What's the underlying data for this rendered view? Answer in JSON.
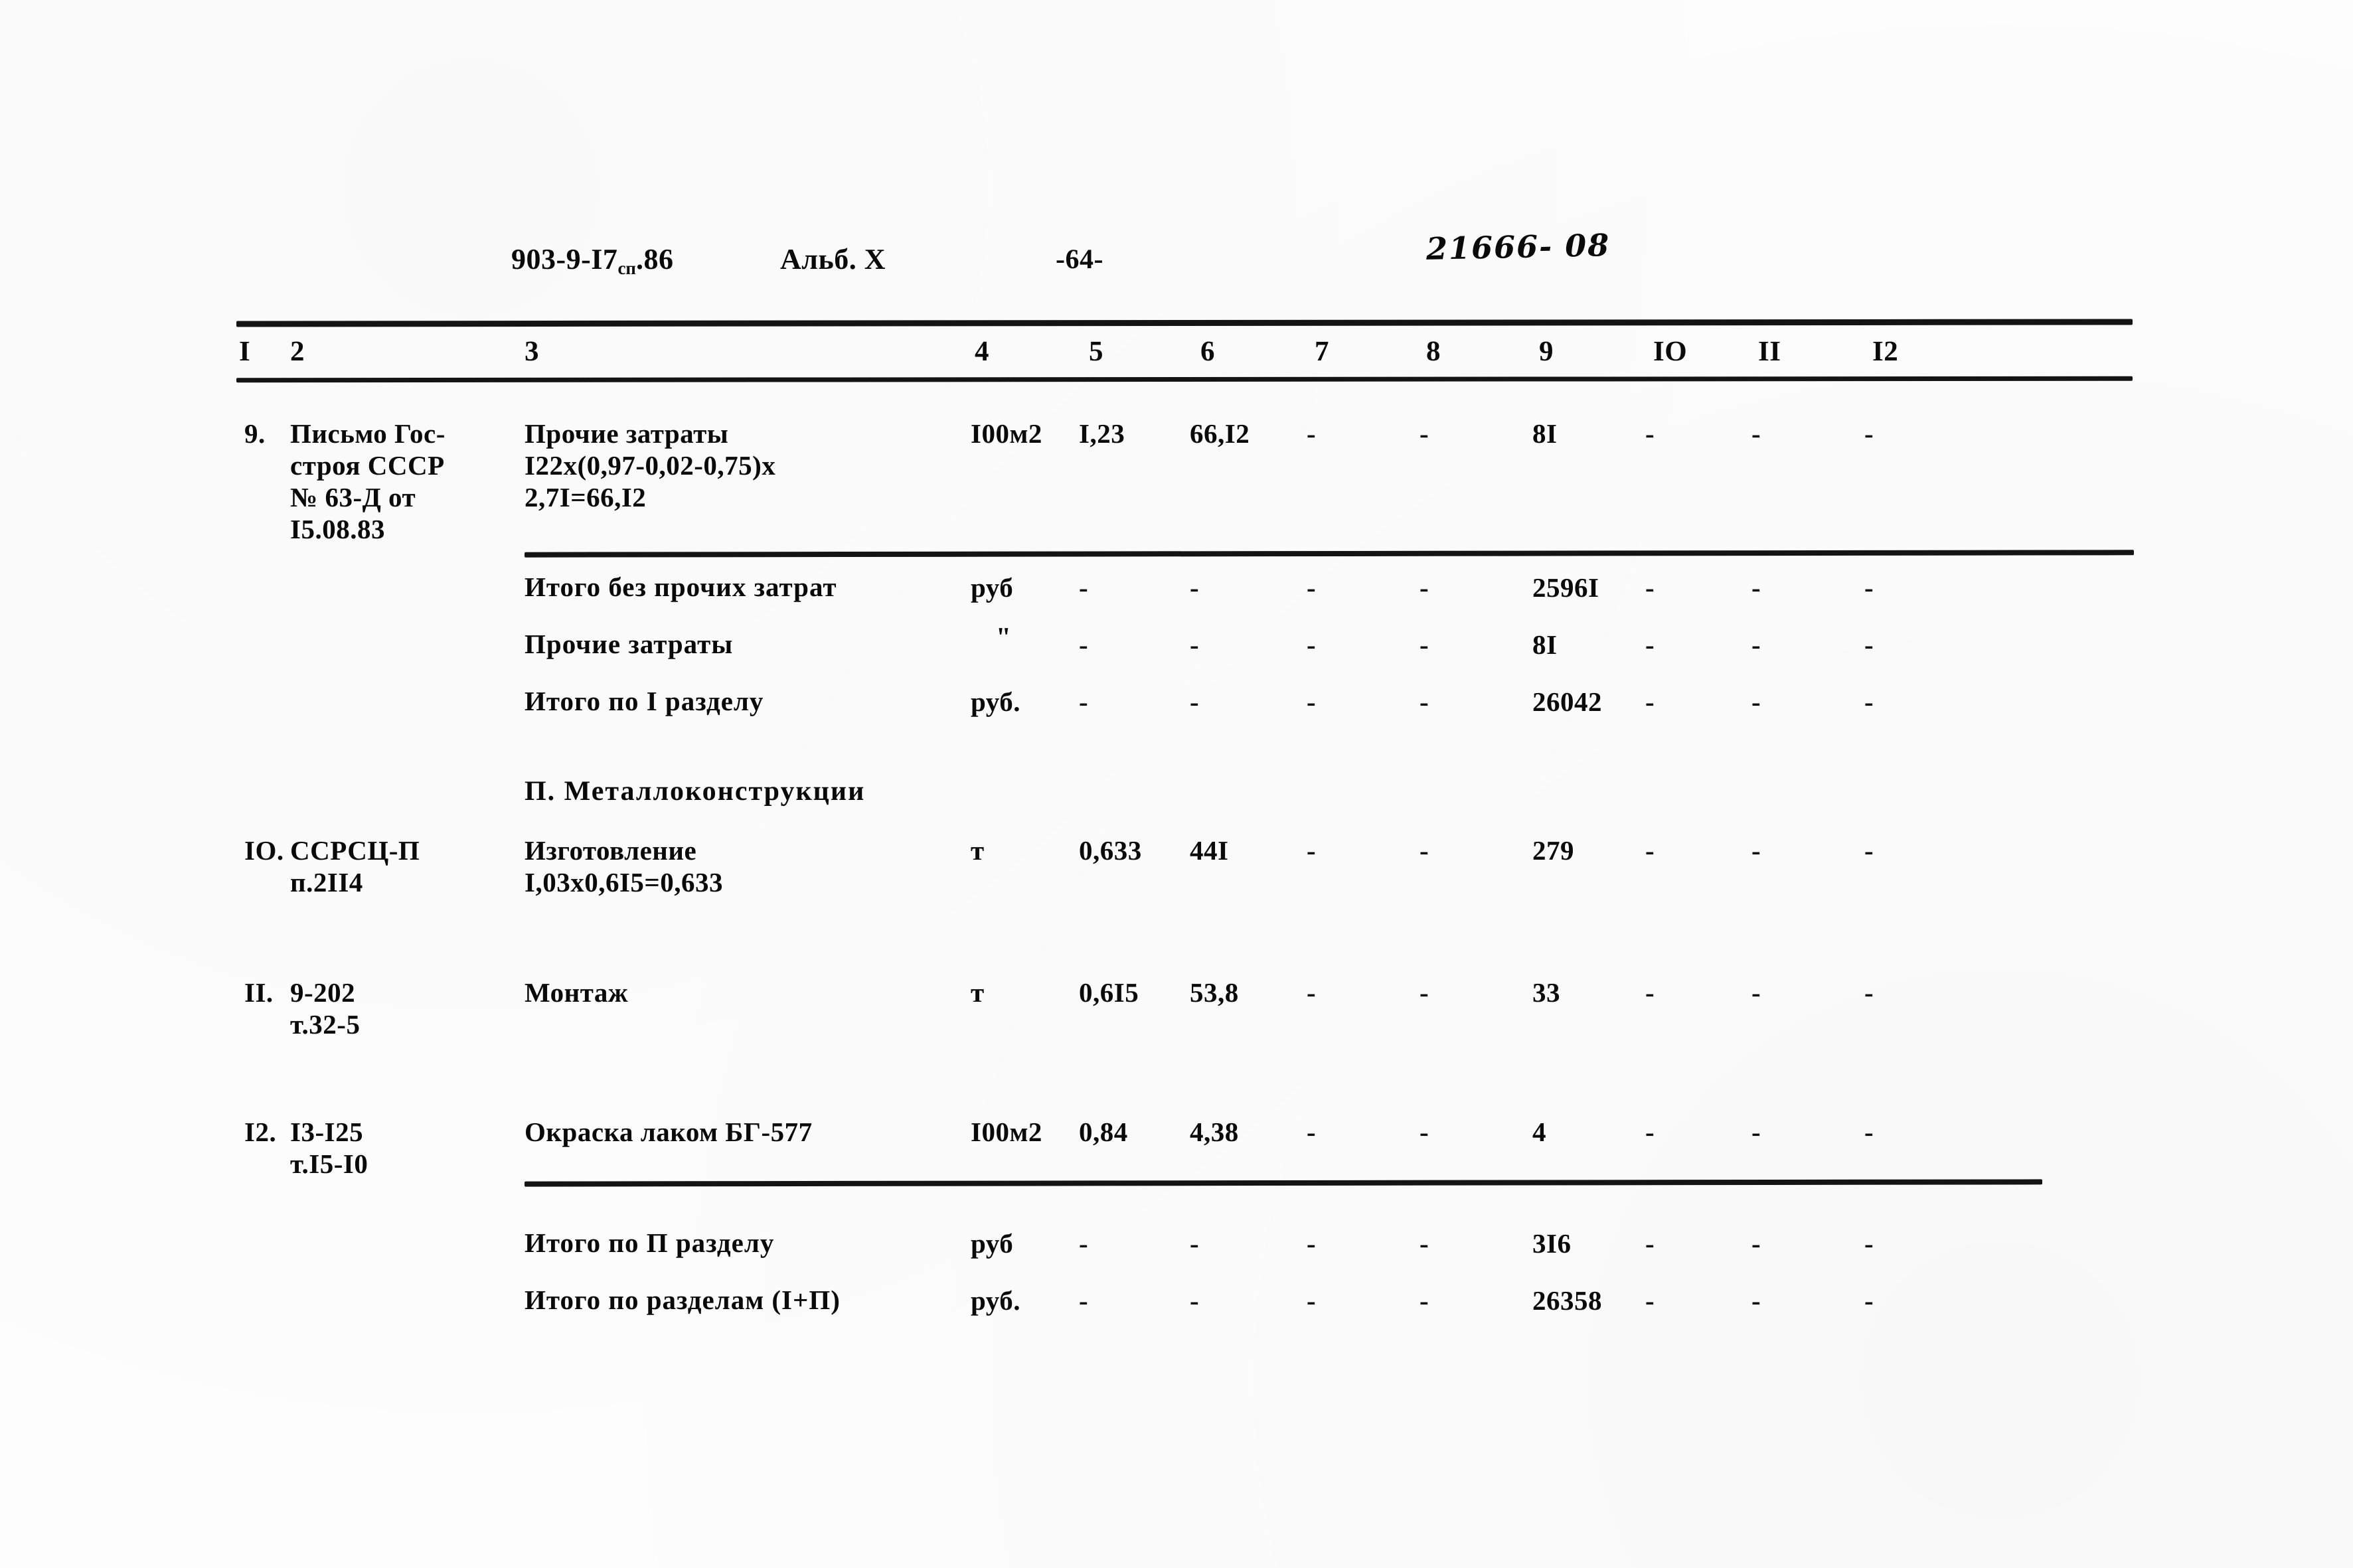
{
  "header": {
    "doc_code_main": "903-9-I7",
    "doc_code_sub": "сп",
    "doc_code_tail": ".86",
    "album_label": "Альб. Х",
    "page_number": "-64-",
    "archive_number": "21666- 08"
  },
  "table": {
    "column_numbers": [
      "I",
      "2",
      "3",
      "4",
      "5",
      "6",
      "7",
      "8",
      "9",
      "IO",
      "II",
      "I2"
    ],
    "rows": [
      {
        "kind": "item",
        "ordinal": "9.",
        "justification": [
          "Письмо Гос-",
          "строя СССР",
          "№ 63-Д от",
          "I5.08.83"
        ],
        "description": [
          "Прочие затраты",
          "I22х(0,97-0,02-0,75)х",
          "2,7I=66,I2"
        ],
        "unit": "I00м2",
        "col5": "I,23",
        "col6": "66,I2",
        "col7": "-",
        "col8": "-",
        "col9": "8I",
        "col10": "-",
        "col11": "-",
        "col12": "-"
      },
      {
        "kind": "summary",
        "label": "Итого без прочих затрат",
        "unit": "руб",
        "col5": "-",
        "col6": "-",
        "col7": "-",
        "col8": "-",
        "col9": "2596I",
        "col10": "-",
        "col11": "-",
        "col12": "-"
      },
      {
        "kind": "summary",
        "label": "Прочие затраты",
        "unit": "\"",
        "col5": "-",
        "col6": "-",
        "col7": "-",
        "col8": "-",
        "col9": "8I",
        "col10": "-",
        "col11": "-",
        "col12": "-"
      },
      {
        "kind": "summary",
        "label": "Итого по I разделу",
        "unit": "руб.",
        "col5": "-",
        "col6": "-",
        "col7": "-",
        "col8": "-",
        "col9": "26042",
        "col10": "-",
        "col11": "-",
        "col12": "-"
      },
      {
        "kind": "section",
        "title": "П. Металлоконструкции"
      },
      {
        "kind": "item",
        "ordinal": "IO.",
        "justification": [
          "ССРСЦ-П",
          "п.2II4"
        ],
        "description": [
          "Изготовление",
          "I,03х0,6I5=0,633"
        ],
        "unit": "т",
        "col5": "0,633",
        "col6": "44I",
        "col7": "-",
        "col8": "-",
        "col9": "279",
        "col10": "-",
        "col11": "-",
        "col12": "-"
      },
      {
        "kind": "item",
        "ordinal": "II.",
        "justification": [
          "9-202",
          "т.32-5"
        ],
        "description": [
          "Монтаж"
        ],
        "unit": "т",
        "col5": "0,6I5",
        "col6": "53,8",
        "col7": "-",
        "col8": "-",
        "col9": "33",
        "col10": "-",
        "col11": "-",
        "col12": "-"
      },
      {
        "kind": "item",
        "ordinal": "I2.",
        "justification": [
          "I3-I25",
          "т.I5-I0"
        ],
        "description": [
          "Окраска лаком БГ-577"
        ],
        "unit": "I00м2",
        "col5": "0,84",
        "col6": "4,38",
        "col7": "-",
        "col8": "-",
        "col9": "4",
        "col10": "-",
        "col11": "-",
        "col12": "-"
      },
      {
        "kind": "summary",
        "label": "Итого по П разделу",
        "unit": "руб",
        "col5": "-",
        "col6": "-",
        "col7": "-",
        "col8": "-",
        "col9": "3I6",
        "col10": "-",
        "col11": "-",
        "col12": "-"
      },
      {
        "kind": "summary",
        "label": "Итого по разделам (I+П)",
        "unit": "руб.",
        "col5": "-",
        "col6": "-",
        "col7": "-",
        "col8": "-",
        "col9": "26358",
        "col10": "-",
        "col11": "-",
        "col12": "-"
      }
    ]
  }
}
